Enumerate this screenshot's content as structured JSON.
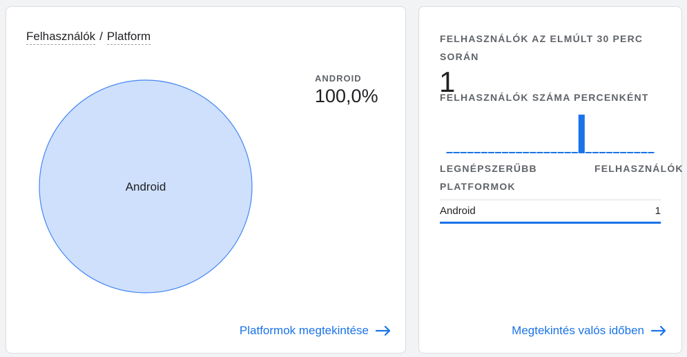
{
  "left_card": {
    "title_dimension_1": "Felhasználók",
    "title_separator": "/",
    "title_dimension_2": "Platform",
    "pie": {
      "slices": [
        {
          "label": "Android",
          "percent": 100.0
        }
      ],
      "fill_color": "#cfe0fc",
      "stroke_color": "#4285f4"
    },
    "legend": {
      "label": "ANDROID",
      "value": "100,0%"
    },
    "link_label": "Platformok megtekintése",
    "link_icon": "arrow-right-icon"
  },
  "right_card": {
    "title": "FELHASZNÁLÓK AZ ELMÚLT 30 PERC SORÁN",
    "count": "1",
    "subtitle": "FELHASZNÁLÓK SZÁMA PERCENKÉNT",
    "per_minute_users": [
      0,
      0,
      0,
      0,
      0,
      0,
      0,
      0,
      0,
      0,
      0,
      0,
      0,
      0,
      0,
      0,
      0,
      0,
      0,
      1,
      0,
      0,
      0,
      0,
      0,
      0,
      0,
      0,
      0,
      0
    ],
    "bar_color": "#1a73e8",
    "table": {
      "header_left": "LEGNÉPSZERŰBB PLATFORMOK",
      "header_right": "FELHASZNÁLÓK",
      "rows": [
        {
          "name": "Android",
          "value": "1"
        }
      ]
    },
    "link_label": "Megtekintés valós időben",
    "link_icon": "arrow-right-icon"
  }
}
